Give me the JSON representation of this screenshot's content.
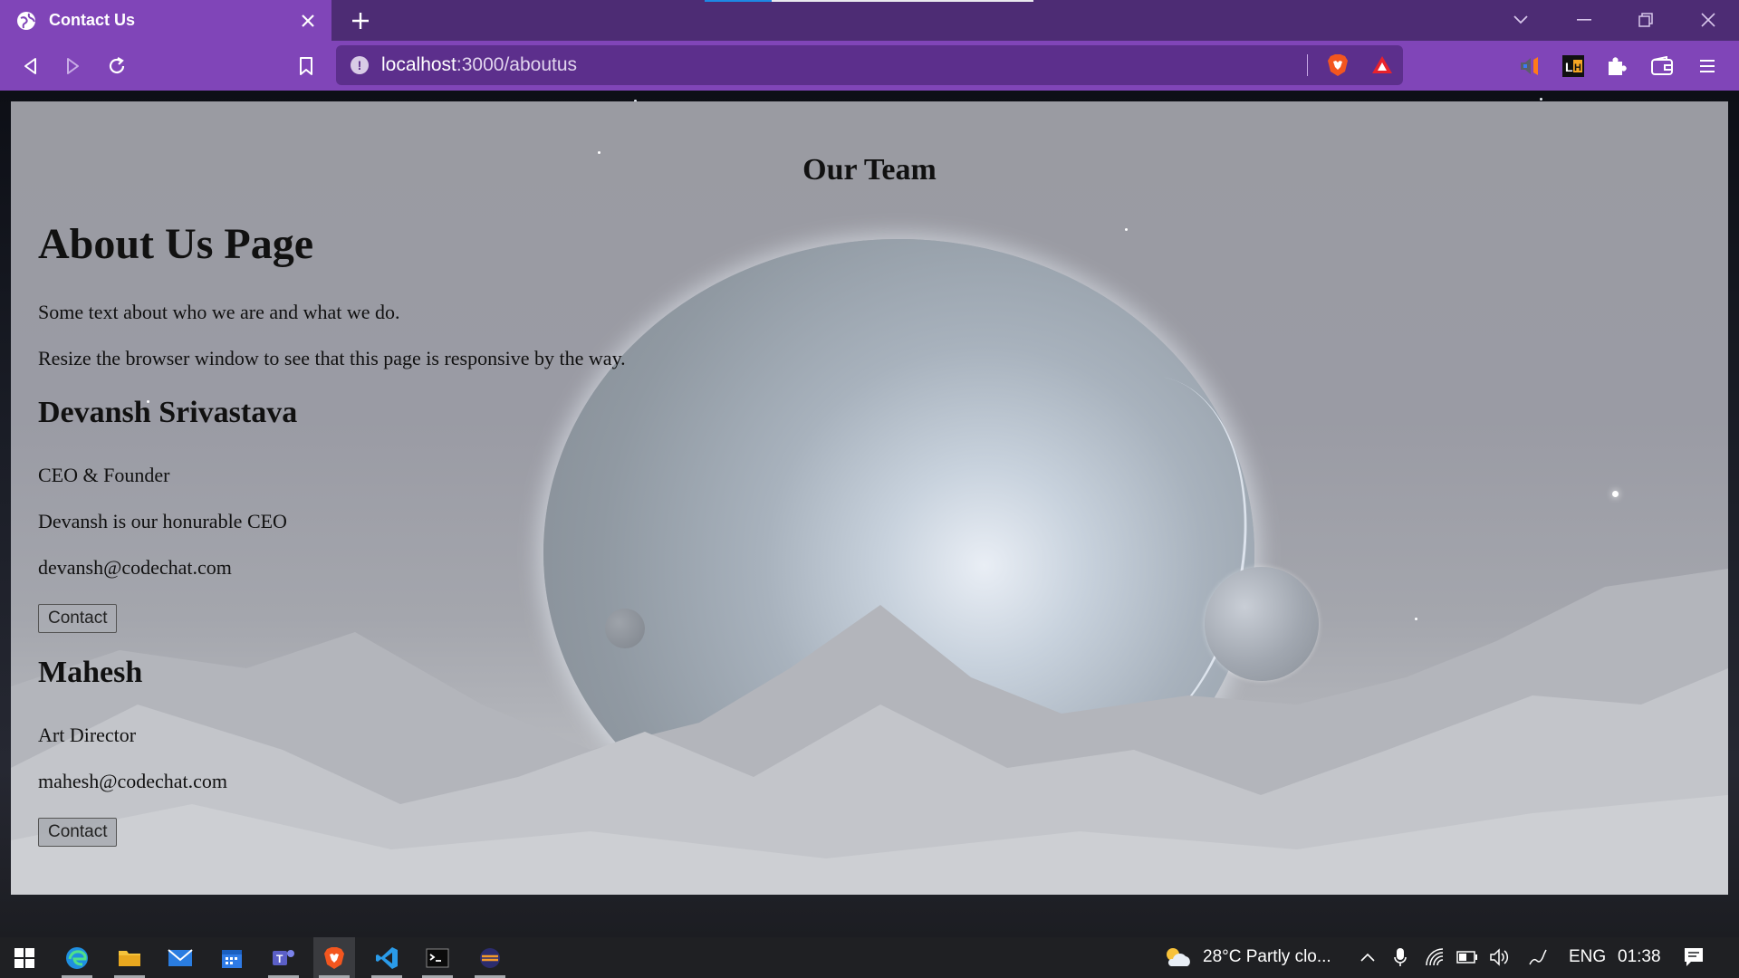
{
  "browser": {
    "tab_title": "Contact Us",
    "new_tab_symbol": "+",
    "url_host": "localhost",
    "url_path": ":3000/aboutus",
    "url_info_symbol": "!",
    "extensions": [
      "volume-extension-icon",
      "lighthouse-extension-icon",
      "puzzle-extensions-icon",
      "wallet-icon",
      "menu-icon"
    ]
  },
  "page": {
    "team_title": "Our Team",
    "heading": "About Us Page",
    "intro": "Some text about who we are and what we do.",
    "resize_note": "Resize the browser window to see that this page is responsive by the way.",
    "members": [
      {
        "name": "Devansh Srivastava",
        "role": "CEO & Founder",
        "bio": "Devansh is our honurable CEO",
        "email": "devansh@codechat.com",
        "button": "Contact"
      },
      {
        "name": "Mahesh",
        "role": "Art Director",
        "email": "mahesh@codechat.com",
        "button": "Contact"
      }
    ]
  },
  "taskbar": {
    "apps": [
      "start-icon",
      "edge-icon",
      "file-explorer-icon",
      "mail-icon",
      "calendar-icon",
      "teams-icon",
      "brave-icon",
      "vscode-icon",
      "terminal-icon",
      "app-icon"
    ],
    "weather": "28°C  Partly clo...",
    "language": "ENG",
    "time": "01:38"
  },
  "colors": {
    "tab_active": "#8045b8",
    "tabbar": "#4d2c74",
    "url_bg": "#5c2f8c",
    "taskbar": "#1f2023"
  }
}
